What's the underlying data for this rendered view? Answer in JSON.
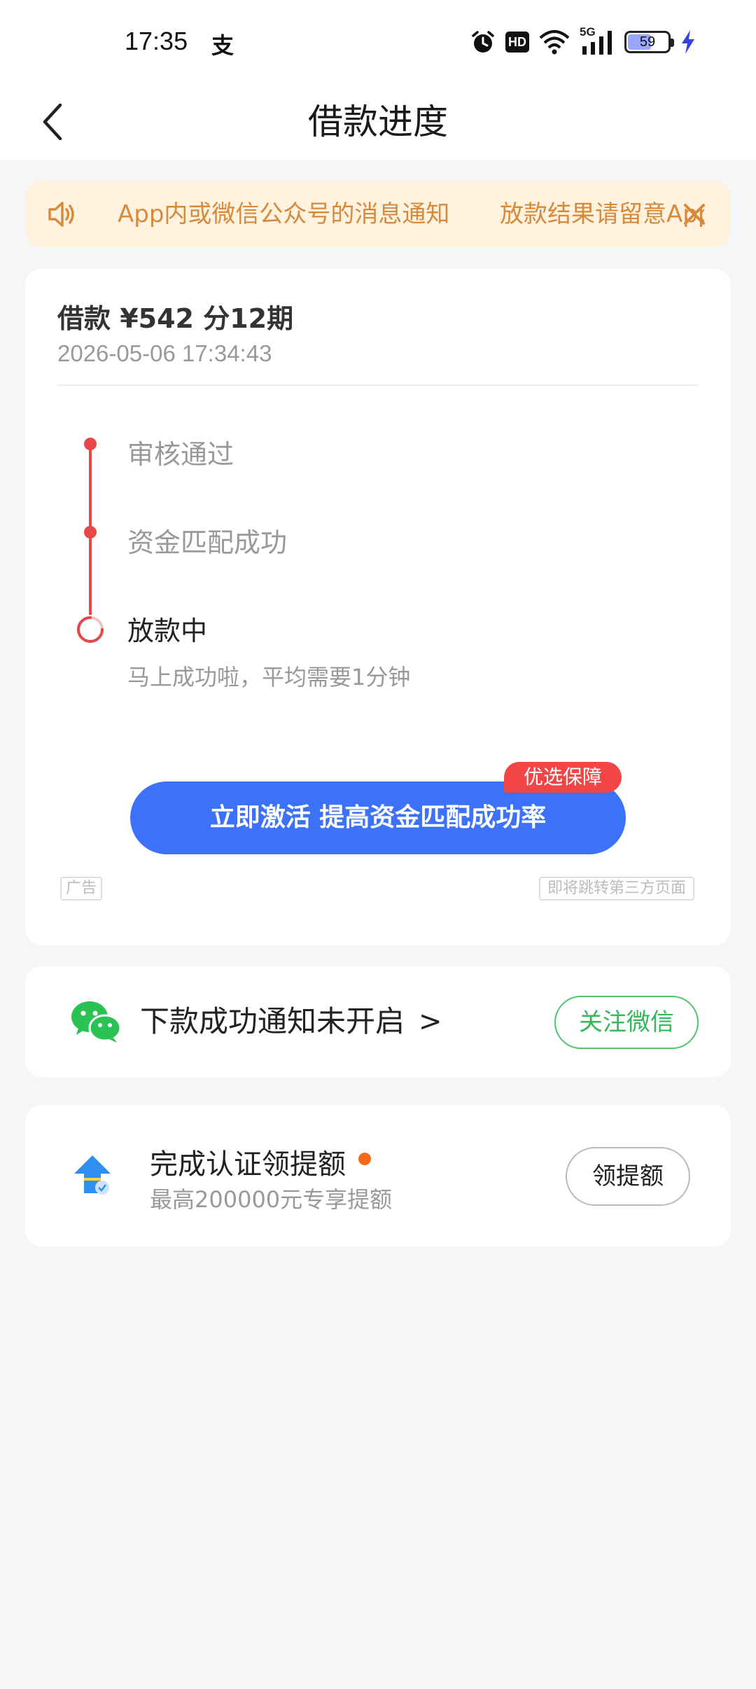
{
  "status_bar": {
    "time": "17:35",
    "app_glyph": "支",
    "hd_label": "HD",
    "network_label": "5G",
    "battery_level": 59,
    "battery_text": "59",
    "icons": [
      "alarm-icon",
      "hd-icon",
      "wifi-icon",
      "signal-5g-icon",
      "battery-icon",
      "charging-icon"
    ]
  },
  "nav": {
    "title": "借款进度",
    "back_icon": "chevron-left-icon"
  },
  "notice": {
    "text_1": "App内或微信公众号的消息通知",
    "text_2": "放款结果请留意App",
    "icon": "speaker-icon",
    "close_icon": "close-icon"
  },
  "loan": {
    "title": "借款 ¥542  分12期",
    "time": "2026-05-06 17:34:43",
    "steps": [
      {
        "label": "审核通过",
        "status": "done"
      },
      {
        "label": "资金匹配成功",
        "status": "done"
      },
      {
        "label": "放款中",
        "status": "active",
        "sub": "马上成功啦，平均需要1分钟"
      }
    ],
    "cta_label": "立即激活 提高资金匹配成功率",
    "cta_badge": "优选保障",
    "ad_label": "广告",
    "third_party_label": "即将跳转第三方页面"
  },
  "wechat": {
    "text": "下款成功通知未开启",
    "chevron": ">",
    "button_label": "关注微信",
    "icon": "wechat-icon"
  },
  "cert": {
    "title": "完成认证领提额",
    "sub": "最高200000元专享提额",
    "button_label": "领提额",
    "icon": "upgrade-arrow-icon"
  },
  "colors": {
    "accent_blue": "#3c72fa",
    "accent_red": "#e8474a",
    "wechat_green": "#33b85a",
    "notice_bg": "#fff2de",
    "notice_text": "#d68a3c"
  }
}
